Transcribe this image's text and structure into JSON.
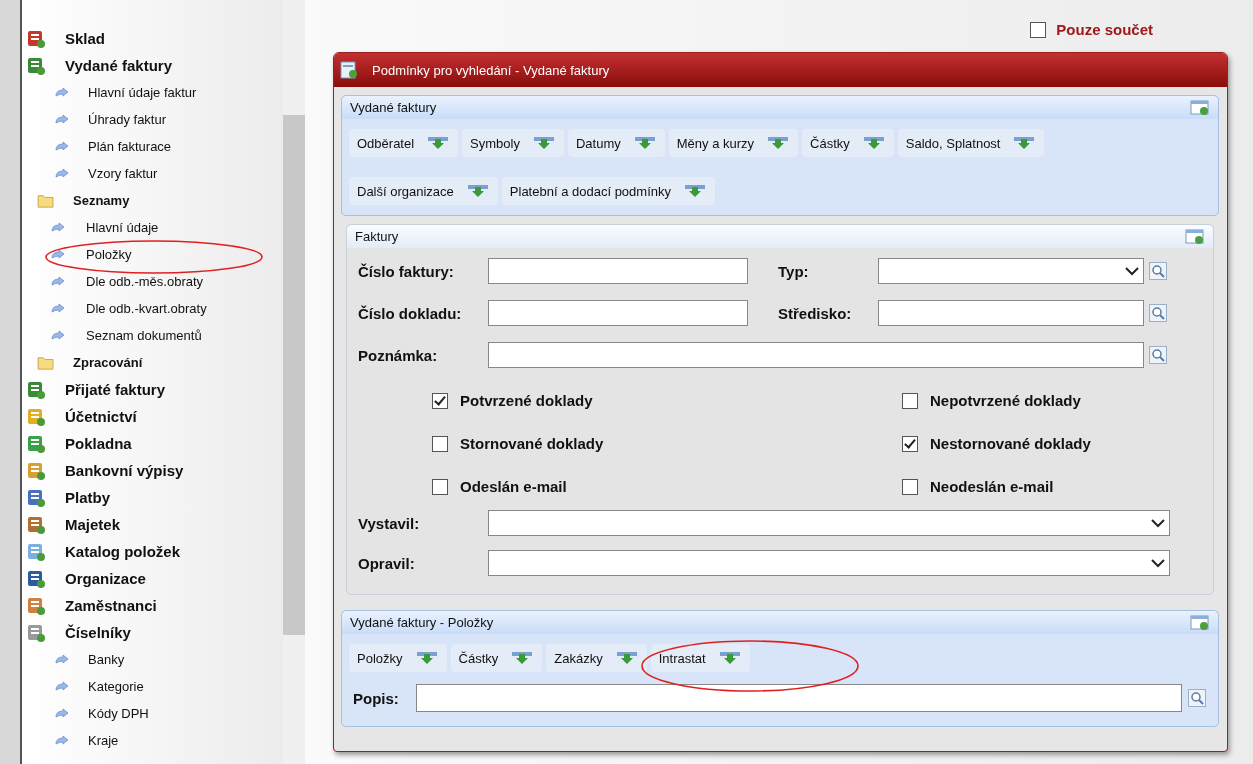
{
  "sidebar": {
    "items": [
      {
        "label": "Sklad",
        "kind": "module"
      },
      {
        "label": "Vydané faktury",
        "kind": "module",
        "children": [
          {
            "label": "Hlavní údaje faktur",
            "kind": "page"
          },
          {
            "label": "Úhrady faktur",
            "kind": "page"
          },
          {
            "label": "Plán fakturace",
            "kind": "page"
          },
          {
            "label": "Vzory faktur",
            "kind": "page"
          },
          {
            "label": "Seznamy",
            "kind": "folder",
            "children": [
              {
                "label": "Hlavní údaje",
                "kind": "page"
              },
              {
                "label": "Položky",
                "kind": "page"
              },
              {
                "label": "Dle odb.-měs.obraty",
                "kind": "page"
              },
              {
                "label": "Dle odb.-kvart.obraty",
                "kind": "page"
              },
              {
                "label": "Seznam dokumentů",
                "kind": "page"
              }
            ]
          },
          {
            "label": "Zpracování",
            "kind": "folder"
          }
        ]
      },
      {
        "label": "Přijaté faktury",
        "kind": "module"
      },
      {
        "label": "Účetnictví",
        "kind": "module"
      },
      {
        "label": "Pokladna",
        "kind": "module"
      },
      {
        "label": "Bankovní výpisy",
        "kind": "module"
      },
      {
        "label": "Platby",
        "kind": "module"
      },
      {
        "label": "Majetek",
        "kind": "module"
      },
      {
        "label": "Katalog položek",
        "kind": "module"
      },
      {
        "label": "Organizace",
        "kind": "module"
      },
      {
        "label": "Zaměstnanci",
        "kind": "module"
      },
      {
        "label": "Číselníky",
        "kind": "module",
        "children": [
          {
            "label": "Banky",
            "kind": "page"
          },
          {
            "label": "Kategorie",
            "kind": "page"
          },
          {
            "label": "Kódy DPH",
            "kind": "page"
          },
          {
            "label": "Kraje",
            "kind": "page"
          }
        ]
      }
    ]
  },
  "sum_only": {
    "label": "Pouze součet",
    "checked": false
  },
  "panel": {
    "title": "Podmínky pro vyhledání - Vydané faktury",
    "invoice_section": {
      "title": "Vydané faktury",
      "button_rows": [
        [
          "Odběratel",
          "Symboly",
          "Datumy",
          "Měny a kurzy",
          "Částky",
          "Saldo, Splatnost"
        ],
        [
          "Další organizace",
          "Platební a dodací podmínky"
        ]
      ]
    },
    "faktury_section": {
      "title": "Faktury",
      "rows": [
        [
          {
            "label": "Číslo faktury:",
            "kind": "text",
            "lookup": false
          },
          {
            "label": "Typ:",
            "kind": "select",
            "lookup": true
          }
        ],
        [
          {
            "label": "Číslo dokladu:",
            "kind": "text",
            "lookup": false
          },
          {
            "label": "Středisko:",
            "kind": "text",
            "lookup": true
          }
        ],
        [
          {
            "label": "Poznámka:",
            "kind": "text",
            "lookup": true
          }
        ]
      ],
      "checkboxes": [
        {
          "label": "Potvrzené doklady",
          "checked": true
        },
        {
          "label": "Nepotvrzené doklady",
          "checked": false
        },
        {
          "label": "Stornované doklady",
          "checked": false
        },
        {
          "label": "Nestornované doklady",
          "checked": true
        },
        {
          "label": "Odeslán e-mail",
          "checked": false
        },
        {
          "label": "Neodeslán e-mail",
          "checked": false
        }
      ],
      "selects": [
        {
          "label": "Vystavil:"
        },
        {
          "label": "Opravil:"
        }
      ]
    },
    "items_section": {
      "title": "Vydané faktury - Položky",
      "buttons": [
        "Položky",
        "Částky",
        "Zakázky",
        "Intrastat"
      ],
      "field": {
        "label": "Popis:",
        "lookup": true
      }
    }
  }
}
